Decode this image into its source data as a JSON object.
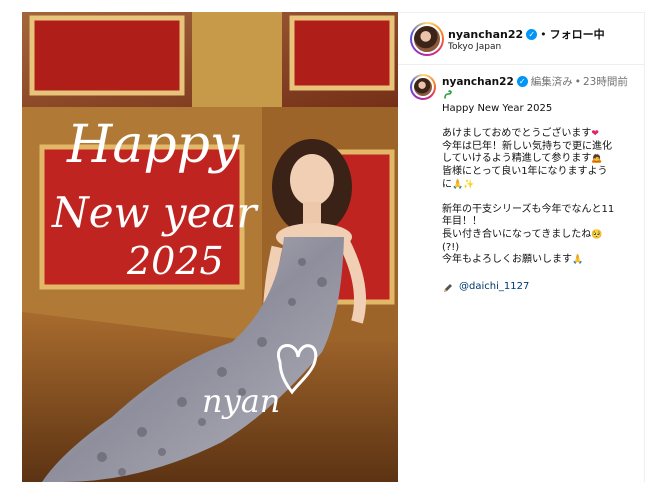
{
  "header": {
    "username": "nyanchan22",
    "verified_mark": "✓",
    "separator": "•",
    "follow_status": "フォロー中",
    "location": "Tokyo Japan"
  },
  "photo": {
    "description_icon": "photo",
    "handwriting": {
      "line1": "Happy",
      "line2": "New year",
      "line3": "2025",
      "signature": "nyan"
    }
  },
  "caption": {
    "username": "nyanchan22",
    "verified_mark": "✓",
    "edited_label": "編集済み",
    "separator": "•",
    "time_ago": "23時間前",
    "lines": {
      "l1": "Happy New Year 2025",
      "l2": "あけましておめでとうございます",
      "l3": "今年は巳年！新しい気持ちで更に進化",
      "l4": "していけるよう精進して参ります",
      "l5": "皆様にとって良い1年になりますよう",
      "l6": "に",
      "l7": "新年の干支シリーズも今年でなんと11",
      "l8": "年目！！",
      "l9": "長い付き合いになってきましたね",
      "l10": "(?!)",
      "l11": "今年もよろしくお願いします"
    },
    "mention": "@daichi_1127",
    "colors": {
      "heart": "#e0245e",
      "verified": "#0095f6",
      "mention": "#00376b",
      "meta": "#737373"
    }
  }
}
